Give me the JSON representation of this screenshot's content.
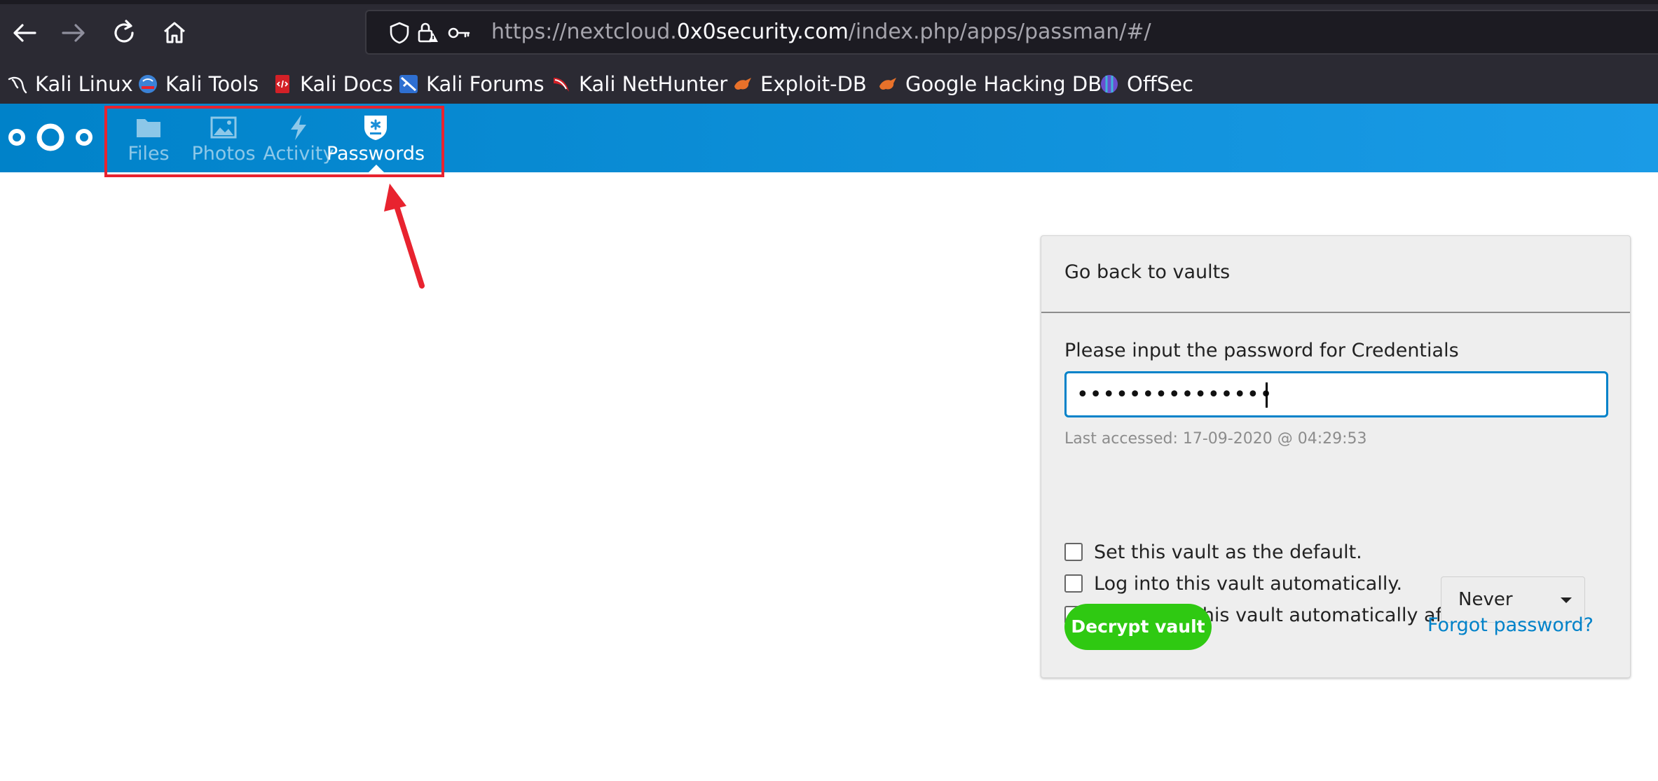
{
  "browser": {
    "url_host_prefix": "https://nextcloud.",
    "url_host": "0x0security.com",
    "url_path": "/index.php/apps/passman/#/"
  },
  "bookmarks": [
    {
      "label": "Kali Linux",
      "icon": "kali-dragon-icon"
    },
    {
      "label": "Kali Tools",
      "icon": "kali-tools-icon"
    },
    {
      "label": "Kali Docs",
      "icon": "kali-docs-icon"
    },
    {
      "label": "Kali Forums",
      "icon": "kali-forums-icon"
    },
    {
      "label": "Kali NetHunter",
      "icon": "nethunter-icon"
    },
    {
      "label": "Exploit-DB",
      "icon": "exploit-db-icon"
    },
    {
      "label": "Google Hacking DB",
      "icon": "ghdb-icon"
    },
    {
      "label": "OffSec",
      "icon": "offsec-icon"
    }
  ],
  "nextcloud": {
    "apps": [
      {
        "label": "Files",
        "icon": "folder-icon",
        "active": false
      },
      {
        "label": "Photos",
        "icon": "image-icon",
        "active": false
      },
      {
        "label": "Activity",
        "icon": "lightning-icon",
        "active": false
      },
      {
        "label": "Passwords",
        "icon": "shield-key-icon",
        "active": true
      }
    ]
  },
  "vault": {
    "back_label": "Go back to vaults",
    "prompt": "Please input the password for Credentials",
    "password_value": "•••••••••••••••",
    "last_accessed": "Last accessed: 17-09-2020 @ 04:29:53",
    "options": [
      {
        "label": "Set this vault as the default.",
        "checked": false
      },
      {
        "label": "Log into this vault automatically.",
        "checked": false
      },
      {
        "label": "Log out of this vault automatically after:",
        "checked": false
      }
    ],
    "logout_select_value": "Never",
    "decrypt_label": "Decrypt vault",
    "forgot_label": "Forgot password?"
  },
  "colors": {
    "nextcloud_blue": "#0082c9",
    "decrypt_green": "#2fc912",
    "annotation_red": "#e8232f"
  }
}
